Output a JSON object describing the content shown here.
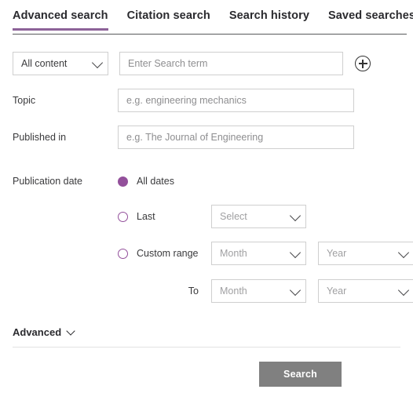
{
  "colors": {
    "accent_purple": "#93509b",
    "tab_underline": "#8c6298",
    "button_disabled": "#808080",
    "field_border": "#cfcfcf",
    "text": "#2b2b2b",
    "placeholder": "#8e8e90"
  },
  "tabs": [
    {
      "label": "Advanced search",
      "active": true
    },
    {
      "label": "Citation search",
      "active": false
    },
    {
      "label": "Search history",
      "active": false
    },
    {
      "label": "Saved searches",
      "active": false
    }
  ],
  "search_row": {
    "content_select": {
      "value": "All content",
      "options": [
        "All content"
      ],
      "chevron_icon": "chevron-down-icon"
    },
    "term_input": {
      "value": "",
      "placeholder": "Enter Search term"
    },
    "add_button": {
      "icon": "circle-plus-icon"
    }
  },
  "fields": {
    "topic": {
      "label": "Topic",
      "value": "",
      "placeholder": "e.g. engineering mechanics"
    },
    "published_in": {
      "label": "Published in",
      "value": "",
      "placeholder": "e.g. The Journal of Engineering"
    }
  },
  "publication_date": {
    "label": "Publication date",
    "options": [
      {
        "label": "All dates",
        "selected": true
      },
      {
        "label": "Last",
        "selected": false
      },
      {
        "label": "Custom range",
        "selected": false
      }
    ],
    "last_select": {
      "value": "",
      "placeholder": "Select",
      "chevron_icon": "chevron-down-icon"
    },
    "custom_range": {
      "from_month": {
        "value": "",
        "placeholder": "Month",
        "chevron_icon": "chevron-down-icon"
      },
      "from_year": {
        "value": "",
        "placeholder": "Year",
        "chevron_icon": "chevron-down-icon"
      },
      "to_label": "To",
      "to_month": {
        "value": "",
        "placeholder": "Month",
        "chevron_icon": "chevron-down-icon"
      },
      "to_year": {
        "value": "",
        "placeholder": "Year",
        "chevron_icon": "chevron-down-icon"
      }
    }
  },
  "advanced": {
    "label": "Advanced",
    "chevron_icon": "chevron-down-icon",
    "expanded": false
  },
  "footer": {
    "search_button": "Search"
  }
}
